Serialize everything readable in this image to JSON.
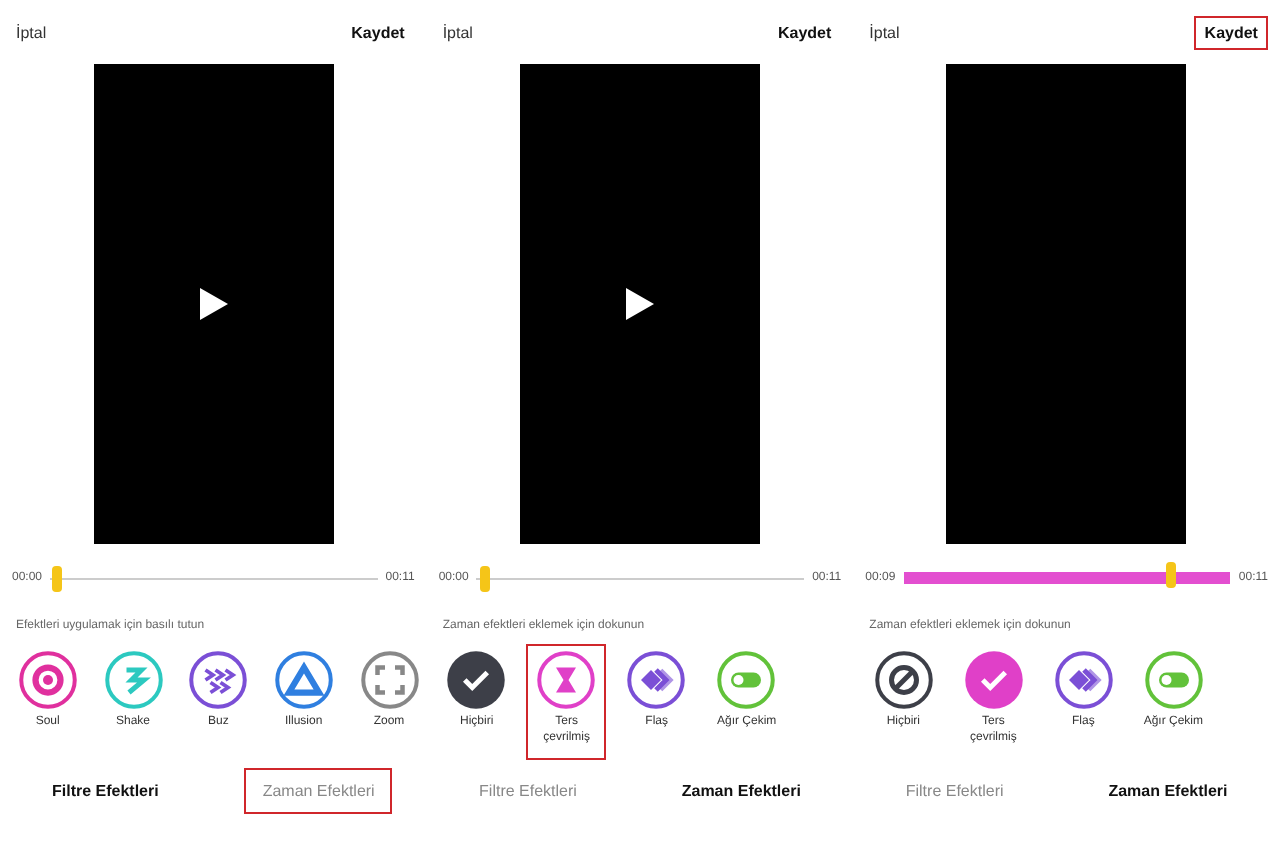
{
  "panels": [
    {
      "cancel": "İptal",
      "save": {
        "label": "Kaydet",
        "highlighted": false
      },
      "video": {
        "play_button": true
      },
      "timeline": {
        "start": "00:00",
        "end": "00:11",
        "level": 0.02,
        "effect_applied": false
      },
      "hint": "Efektleri uygulamak için basılı tutun",
      "effects": [
        {
          "kind": "soul",
          "label": "Soul",
          "color": "#e0309e",
          "selected": false,
          "highlighted": false
        },
        {
          "kind": "shake",
          "label": "Shake",
          "color": "#2cc9c0",
          "selected": false,
          "highlighted": false
        },
        {
          "kind": "buzz",
          "label": "Buz",
          "color": "#7b4fd6",
          "selected": false,
          "highlighted": false
        },
        {
          "kind": "illusion",
          "label": "Illusion",
          "color": "#2f7fe0",
          "selected": false,
          "highlighted": false
        },
        {
          "kind": "zoom",
          "label": "Zoom",
          "color": "#888888",
          "selected": false,
          "highlighted": false
        }
      ],
      "tabs": [
        {
          "label": "Filtre Efektleri",
          "selected": true,
          "highlighted": false
        },
        {
          "label": "Zaman Efektleri",
          "selected": false,
          "highlighted": true
        }
      ]
    },
    {
      "cancel": "İptal",
      "save": {
        "label": "Kaydet",
        "highlighted": false
      },
      "video": {
        "play_button": true
      },
      "timeline": {
        "start": "00:00",
        "end": "00:11",
        "level": 0.02,
        "effect_applied": false
      },
      "hint": "Zaman efektleri eklemek için dokunun",
      "effects": [
        {
          "kind": "none",
          "label": "Hiçbiri",
          "color": "#3d3f48",
          "selected": true,
          "highlighted": false
        },
        {
          "kind": "reverse",
          "label": "Ters çevrilmiş",
          "color": "#e040c8",
          "selected": false,
          "highlighted": true
        },
        {
          "kind": "flash",
          "label": "Flaş",
          "color": "#7b4fd6",
          "selected": false,
          "highlighted": false
        },
        {
          "kind": "slowmo",
          "label": "Ağır Çekim",
          "color": "#62c23a",
          "selected": false,
          "highlighted": false
        }
      ],
      "tabs": [
        {
          "label": "Filtre Efektleri",
          "selected": false,
          "highlighted": false
        },
        {
          "label": "Zaman Efektleri",
          "selected": true,
          "highlighted": false
        }
      ]
    },
    {
      "cancel": "İptal",
      "save": {
        "label": "Kaydet",
        "highlighted": true
      },
      "video": {
        "play_button": false
      },
      "timeline": {
        "start": "00:09",
        "end": "00:11",
        "level": 0.82,
        "effect_applied": true
      },
      "hint": "Zaman efektleri eklemek için dokunun",
      "effects": [
        {
          "kind": "none",
          "label": "Hiçbiri",
          "color": "#3d3f48",
          "selected": false,
          "highlighted": false
        },
        {
          "kind": "reverse",
          "label": "Ters çevrilmiş",
          "color": "#e040c8",
          "selected": true,
          "highlighted": false
        },
        {
          "kind": "flash",
          "label": "Flaş",
          "color": "#7b4fd6",
          "selected": false,
          "highlighted": false
        },
        {
          "kind": "slowmo",
          "label": "Ağır Çekim",
          "color": "#62c23a",
          "selected": false,
          "highlighted": false
        }
      ],
      "tabs": [
        {
          "label": "Filtre Efektleri",
          "selected": false,
          "highlighted": false
        },
        {
          "label": "Zaman Efektleri",
          "selected": true,
          "highlighted": false
        }
      ]
    }
  ]
}
